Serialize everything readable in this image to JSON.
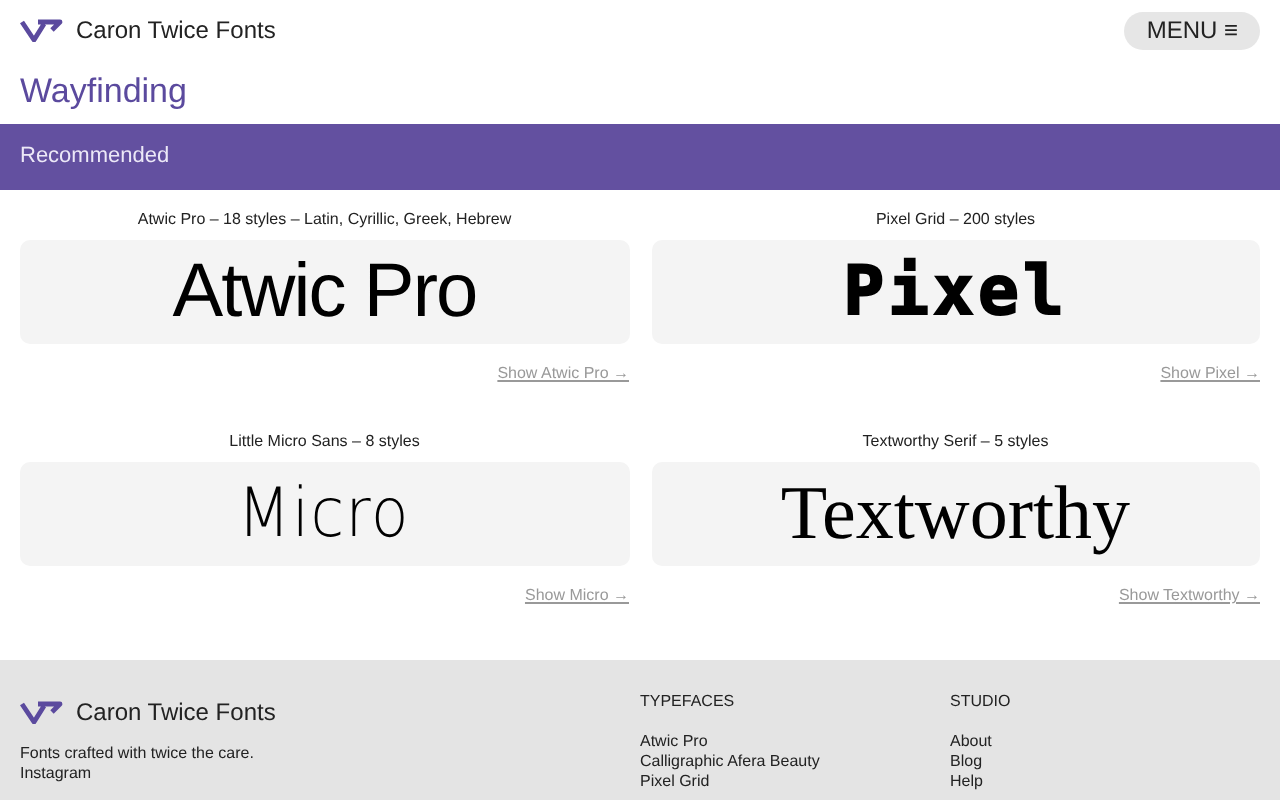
{
  "header": {
    "brand": "Caron Twice Fonts",
    "menu": "MENU ≡"
  },
  "page_title": "Wayfinding",
  "section": "Recommended",
  "fonts": [
    {
      "caption": "Atwic Pro – 18 styles – Latin, Cyrillic, Greek, Hebrew",
      "sample": "Atwic Pro",
      "kind": "sans",
      "link": "Show Atwic Pro →"
    },
    {
      "caption": "Pixel Grid – 200 styles",
      "sample": "Pixel",
      "kind": "pixel",
      "link": "Show Pixel →"
    },
    {
      "caption": "Little Micro Sans – 8 styles",
      "sample": "Micro",
      "kind": "thin",
      "link": "Show Micro →"
    },
    {
      "caption": "Textworthy Serif – 5 styles",
      "sample": "Textworthy",
      "kind": "serif",
      "link": "Show Textworthy →"
    }
  ],
  "footer": {
    "brand": "Caron Twice Fonts",
    "tagline": "Fonts crafted with twice the care.",
    "social": [
      "Instagram"
    ],
    "columns": [
      {
        "heading": "TYPEFACES",
        "links": [
          "Atwic Pro",
          "Calligraphic Afera Beauty",
          "Pixel Grid"
        ]
      },
      {
        "heading": "STUDIO",
        "links": [
          "About",
          "Blog",
          "Help"
        ]
      }
    ]
  }
}
